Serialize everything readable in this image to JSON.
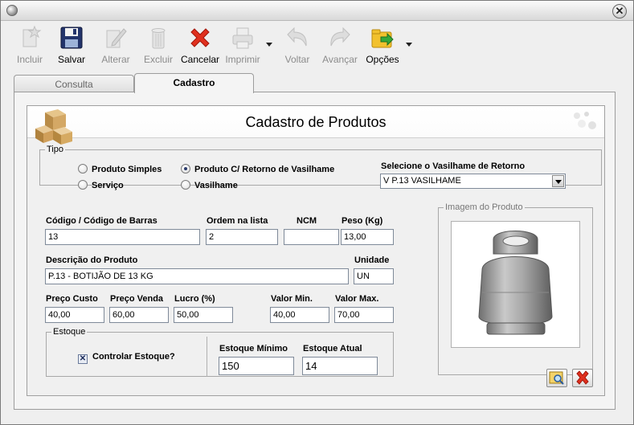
{
  "window": {
    "close_glyph": "✕"
  },
  "toolbar": {
    "buttons": [
      {
        "label": "Incluir",
        "icon": "new-icon",
        "enabled": false
      },
      {
        "label": "Salvar",
        "icon": "floppy-icon",
        "enabled": true
      },
      {
        "label": "Alterar",
        "icon": "edit-icon",
        "enabled": false
      },
      {
        "label": "Excluir",
        "icon": "trash-icon",
        "enabled": false
      },
      {
        "label": "Cancelar",
        "icon": "cancel-x-icon",
        "enabled": true
      },
      {
        "label": "Imprimir",
        "icon": "printer-icon",
        "enabled": false
      },
      {
        "label": "Voltar",
        "icon": "back-arrow-icon",
        "enabled": false
      },
      {
        "label": "Avançar",
        "icon": "forward-arrow-icon",
        "enabled": false
      },
      {
        "label": "Opções",
        "icon": "options-folder-icon",
        "enabled": true
      }
    ]
  },
  "tabs": {
    "consulta": "Consulta",
    "cadastro": "Cadastro"
  },
  "header": {
    "title": "Cadastro de Produtos"
  },
  "tipo": {
    "legend": "Tipo",
    "options": [
      "Produto Simples",
      "Produto C/ Retorno de Vasilhame",
      "Serviço",
      "Vasilhame"
    ],
    "selected": "Produto C/ Retorno de Vasilhame",
    "vasilhame_label": "Selecione o Vasilhame de Retorno",
    "vasilhame_value": "V P.13 VASILHAME"
  },
  "fields": {
    "codigo_label": "Código / Código de  Barras",
    "codigo_value": "13",
    "ordem_label": "Ordem na lista",
    "ordem_value": "2",
    "ncm_label": "NCM",
    "ncm_value": "",
    "peso_label": "Peso (Kg)",
    "peso_value": "13,00",
    "descricao_label": "Descrição do Produto",
    "descricao_value": "P.13 - BOTIJÃO DE 13 KG",
    "unidade_label": "Unidade",
    "unidade_value": "UN",
    "preco_custo_label": "Preço Custo",
    "preco_custo_value": "40,00",
    "preco_venda_label": "Preço Venda",
    "preco_venda_value": "60,00",
    "lucro_label": "Lucro (%)",
    "lucro_value": "50,00",
    "valor_min_label": "Valor Min.",
    "valor_min_value": "40,00",
    "valor_max_label": "Valor Max.",
    "valor_max_value": "70,00"
  },
  "estoque": {
    "legend": "Estoque",
    "controlar_label": "Controlar Estoque?",
    "controlar_checked": true,
    "minimo_label": "Estoque Mínimo",
    "minimo_value": "150",
    "atual_label": "Estoque Atual",
    "atual_value": "14"
  },
  "imagem": {
    "legend": "Imagem do Produto"
  },
  "colors": {
    "disabled_text": "#8c8c8c",
    "cancel_red": "#e0301e",
    "accent_blue": "#2a3a6a"
  }
}
